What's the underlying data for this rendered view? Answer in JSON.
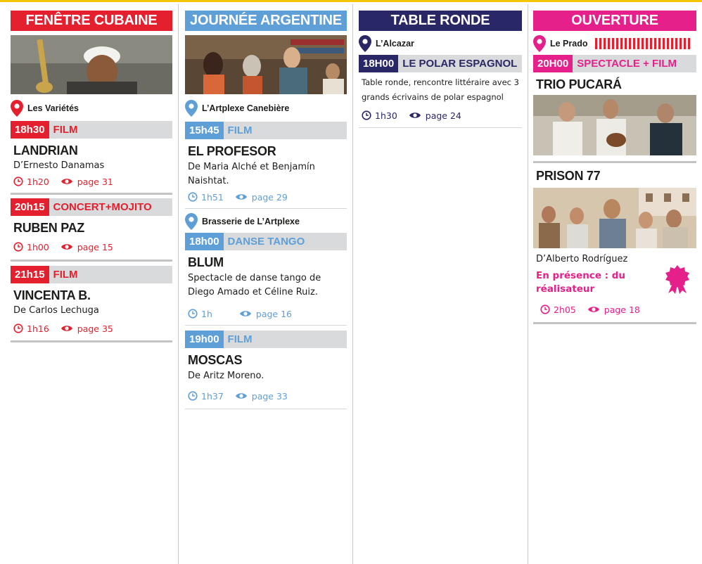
{
  "colors": {
    "red": "#e4202f",
    "blue": "#5f9fd8",
    "navy": "#2a2766",
    "pink": "#e5208b",
    "gold_rule": "#f2c600"
  },
  "icons": {
    "venue": "map-pin-icon",
    "duration": "clock-icon",
    "page": "eye-icon",
    "award": "rosette-badge-icon"
  },
  "columns": [
    {
      "header": "FENÊTRE CUBAINE",
      "venue": "Les Variétés",
      "events": [
        {
          "time": "18h30",
          "kind": "FILM",
          "title": "LANDRIAN",
          "desc": "D’Ernesto Danamas",
          "duration": "1h20",
          "page": "page 31"
        },
        {
          "time": "20h15",
          "kind": "CONCERT+MOJITO",
          "title": "RUBEN PAZ",
          "duration": "1h00",
          "page": "page 15"
        },
        {
          "time": "21h15",
          "kind": "FILM",
          "title": "VINCENTA B.",
          "desc": "De Carlos Lechuga",
          "duration": "1h16",
          "page": "page 35"
        }
      ]
    },
    {
      "header": "JOURNÉE ARGENTINE",
      "venue": "L’Artplexe Canebière",
      "venue2": "Brasserie de L’Artplexe",
      "events": [
        {
          "time": "15h45",
          "kind": "FILM",
          "title": "EL PROFESOR",
          "desc": "De Maria Alché et Benjamín Naishtat.",
          "duration": "1h51",
          "page": "page 29"
        },
        {
          "time": "18h00",
          "kind": "DANSE TANGO",
          "title": "BLUM",
          "desc": "Spectacle de danse tango de Diego Amado et Céline Ruiz.",
          "duration": "1h",
          "page": "page 16"
        },
        {
          "time": "19h00",
          "kind": "FILM",
          "title": "MOSCAS",
          "desc": "De Aritz Moreno.",
          "duration": "1h37",
          "page": "page 33"
        }
      ]
    },
    {
      "header": "TABLE RONDE",
      "venue": "L’Alcazar",
      "events": [
        {
          "time": "18H00",
          "kind": "LE POLAR ESPAGNOL",
          "desc": "Table ronde, rencontre littéraire avec 3 grands écrivains de polar espagnol",
          "duration": "1h30",
          "page": "page 24"
        }
      ]
    },
    {
      "header": "OUVERTURE",
      "venue": "Le Prado",
      "events": [
        {
          "time": "20H00",
          "kind": "SPECTACLE + FILM",
          "title": "TRIO PUCARÁ"
        },
        {
          "title": "PRISON 77",
          "desc": "D’Alberto Rodríguez",
          "presence": "En présence : du réalisateur",
          "duration": "2h05",
          "page": "page 18"
        }
      ]
    }
  ]
}
